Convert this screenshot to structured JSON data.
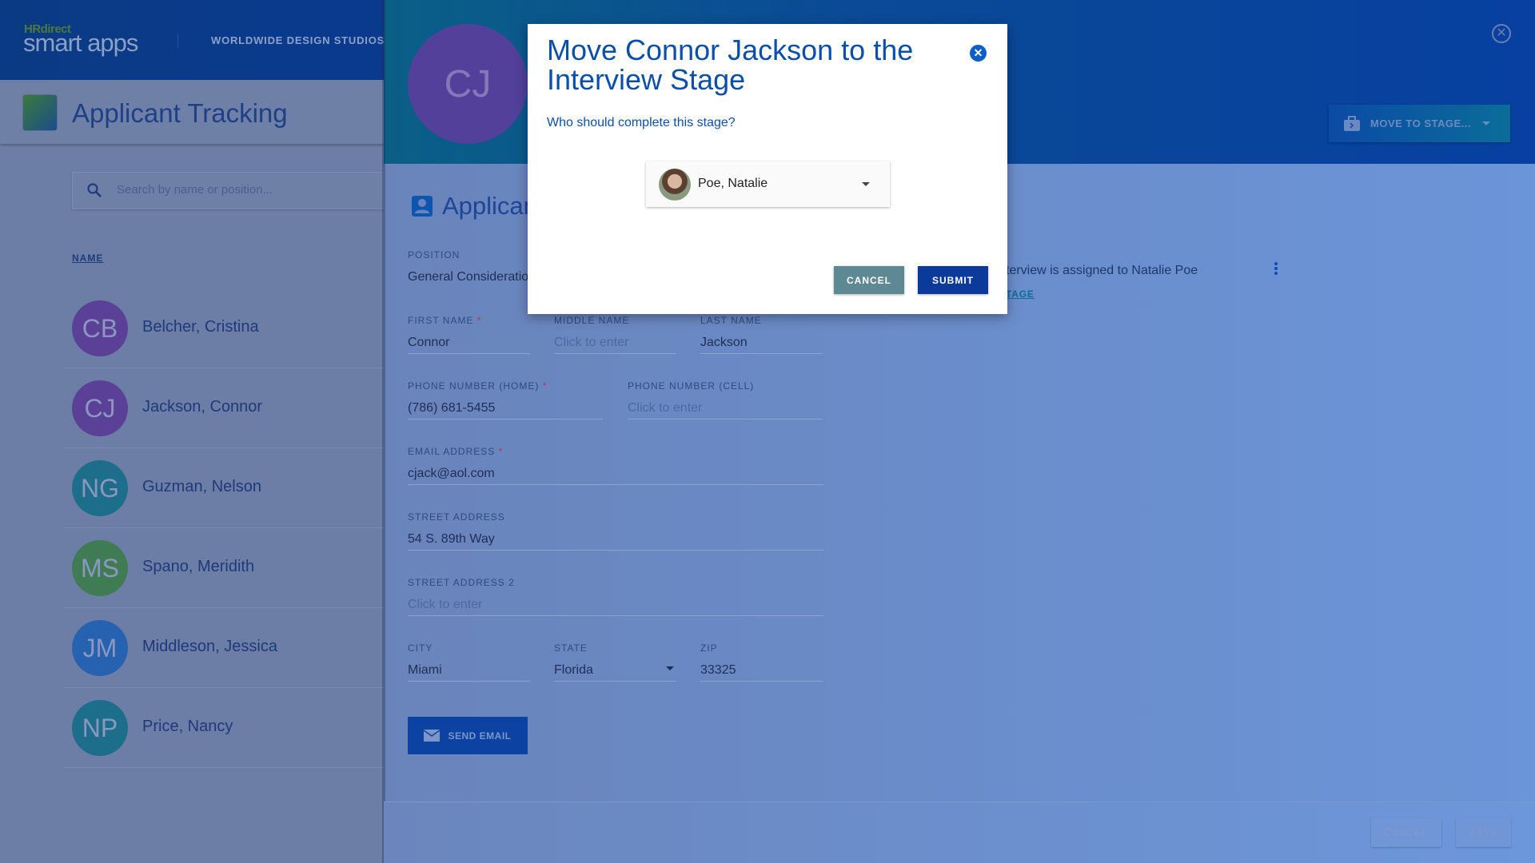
{
  "header": {
    "brand_small": "HRdirect",
    "brand_large": "smart apps",
    "organization": "WORLDWIDE DESIGN STUDIOS"
  },
  "app": {
    "title": "Applicant Tracking"
  },
  "search": {
    "placeholder": "Search by name or position..."
  },
  "list": {
    "column_header": "NAME",
    "items": [
      {
        "initials": "CB",
        "name": "Belcher, Cristina",
        "color": "#5a4096"
      },
      {
        "initials": "CJ",
        "name": "Jackson, Connor",
        "color": "#5a4096"
      },
      {
        "initials": "NG",
        "name": "Guzman, Nelson",
        "color": "#1d6e8a"
      },
      {
        "initials": "MS",
        "name": "Spano, Meridith",
        "color": "#3f7c54"
      },
      {
        "initials": "JM",
        "name": "Middleson, Jessica",
        "color": "#2662b0"
      },
      {
        "initials": "NP",
        "name": "Price, Nancy",
        "color": "#1d6e8a"
      }
    ]
  },
  "detail": {
    "initials": "CJ",
    "move_to_stage": "MOVE TO STAGE...",
    "section_title": "Applicant",
    "position": {
      "label": "POSITION",
      "value": "General Consideration"
    },
    "first_name": {
      "label": "FIRST NAME",
      "value": "Connor"
    },
    "middle_name": {
      "label": "MIDDLE NAME",
      "placeholder": "Click to enter"
    },
    "last_name": {
      "label": "LAST NAME",
      "value": "Jackson"
    },
    "phone_home": {
      "label": "PHONE NUMBER (HOME)",
      "value": "(786) 681-5455"
    },
    "phone_cell": {
      "label": "PHONE NUMBER (CELL)",
      "placeholder": "Click to enter"
    },
    "email": {
      "label": "EMAIL ADDRESS",
      "value": "cjack@aol.com"
    },
    "street": {
      "label": "STREET ADDRESS",
      "value": "54 S. 89th Way"
    },
    "street2": {
      "label": "STREET ADDRESS 2",
      "placeholder": "Click to enter"
    },
    "city": {
      "label": "CITY",
      "value": "Miami"
    },
    "state": {
      "label": "STATE",
      "value": "Florida"
    },
    "zip": {
      "label": "ZIP",
      "value": "33325"
    },
    "required_mark": "*",
    "send_email": "SEND EMAIL",
    "stage_note": "terview is assigned to Natalie Poe",
    "stage_link": "TAGE",
    "cancel": "CANCEL",
    "save": "SAVE"
  },
  "modal": {
    "title": "Move Connor Jackson to the Interview Stage",
    "question": "Who should complete this stage?",
    "assignee": "Poe, Natalie",
    "cancel": "CANCEL",
    "submit": "SUBMIT"
  }
}
